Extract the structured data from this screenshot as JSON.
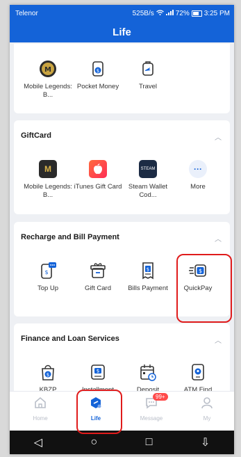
{
  "status": {
    "carrier": "Telenor",
    "speed": "525B/s",
    "battery_pct": "72%",
    "time": "3:25 PM"
  },
  "header": {
    "title": "Life"
  },
  "top_section": {
    "items": [
      {
        "label": "Mobile Legends: B...",
        "icon": "mobile-legends-icon"
      },
      {
        "label": "Pocket Money",
        "icon": "pocket-money-icon"
      },
      {
        "label": "Travel",
        "icon": "travel-icon"
      }
    ]
  },
  "giftcard": {
    "title": "GiftCard",
    "items": [
      {
        "label": "Mobile Legends: B...",
        "icon": "mobile-legends-icon"
      },
      {
        "label": "iTunes Gift Card",
        "icon": "apple-icon"
      },
      {
        "label": "Steam Wallet Cod...",
        "icon": "steam-icon",
        "tile_text": "STEAM"
      },
      {
        "label": "More",
        "icon": "more-icon",
        "tile_text": "···"
      }
    ]
  },
  "recharge": {
    "title": "Recharge and Bill Payment",
    "items": [
      {
        "label": "Top Up",
        "icon": "topup-icon"
      },
      {
        "label": "Gift Card",
        "icon": "gift-icon"
      },
      {
        "label": "Bills Payment",
        "icon": "bill-icon"
      },
      {
        "label": "QuickPay",
        "icon": "quickpay-icon"
      }
    ]
  },
  "finance": {
    "title": "Finance and Loan Services",
    "items": [
      {
        "label": "KBZP",
        "icon": "bag-icon"
      },
      {
        "label": "Installment",
        "icon": "wallet-icon"
      },
      {
        "label": "Deposit",
        "icon": "calendar-icon"
      },
      {
        "label": "ATM Find",
        "icon": "atm-icon"
      }
    ]
  },
  "bottomnav": {
    "items": [
      {
        "label": "Home",
        "icon": "home-icon"
      },
      {
        "label": "Life",
        "icon": "life-icon",
        "active": true
      },
      {
        "label": "Message",
        "icon": "message-icon",
        "badge": "99+"
      },
      {
        "label": "My",
        "icon": "user-icon"
      }
    ]
  },
  "colors": {
    "primary": "#1463d8",
    "highlight": "#e01b1b",
    "badge": "#ff4b4b"
  }
}
